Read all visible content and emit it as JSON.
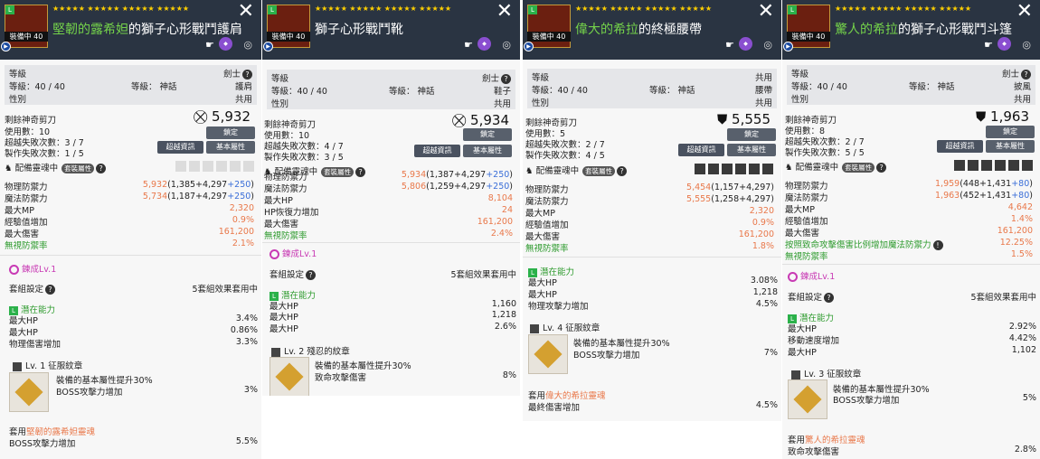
{
  "panels": [
    {
      "stars": "★★★★★ ★★★★★ ★★★★★ ★★★★★",
      "name_prefix": "堅韌的露希妲",
      "name_suffix": "的獅子心形戰鬥護肩",
      "equipped": "裝備中",
      "level_badge": "40",
      "bar": {
        "level_label": "等級",
        "job": "劍士",
        "level": "等級：40 / 40",
        "grade": "等級： 神話",
        "type": "護肩",
        "gender_label": "性別",
        "gender": "共用"
      },
      "scissors": "剩餘神奇剪刀",
      "uses": "使用數：10",
      "fail_transcend": "超越失敗次數：3 / 7",
      "fail_craft": "製作失敗次數：1 / 5",
      "power": "5,932",
      "btn_lock": "鎖定",
      "btn_trans": "超越資訊",
      "btn_basic": "基本屬性",
      "spirit": "配備靈魂中",
      "set_tag": "套裝屬性",
      "stats": [
        {
          "k": "物理防禦力",
          "v": "5,932",
          "d": "(1,385+4,297",
          "p": "+250",
          "e": ")"
        },
        {
          "k": "魔法防禦力",
          "v": "5,734",
          "d": "(1,187+4,297",
          "p": "+250",
          "e": ")"
        },
        {
          "k": "最大MP",
          "v": "2,320"
        },
        {
          "k": "經驗值增加",
          "v": "0.9%"
        },
        {
          "k": "最大傷害",
          "v": "161,200"
        },
        {
          "k": "無視防禦率",
          "v": "2.1%"
        }
      ],
      "refine": "鍊成Lv.1",
      "set_label": "套組設定",
      "set_value": "5套組效果套用中",
      "potential": "潛在能力",
      "pot": [
        {
          "k": "最大HP",
          "v": "3.4%"
        },
        {
          "k": "最大HP",
          "v": "0.86%"
        },
        {
          "k": "物理傷害增加",
          "v": "3.3%"
        }
      ],
      "emblem_title": "Lv. 1 征服紋章",
      "emblem_line1": "裝備的基本屬性提升30%",
      "emblem_line2": "BOSS攻擊力增加",
      "emblem_val": "3%",
      "soul_prefix": "套用",
      "soul_name": "堅韌的露希妲靈魂",
      "soul_line": "BOSS攻擊力增加",
      "soul_val": "5.5%"
    },
    {
      "stars": "★★★★★ ★★★★★ ★★★★★ ★★★★★",
      "name_prefix": "",
      "name_suffix": "獅子心形戰鬥靴",
      "equipped": "裝備中",
      "level_badge": "40",
      "bar": {
        "level_label": "等級",
        "job": "劍士",
        "level": "等級：40 / 40",
        "grade": "等級： 神話",
        "type": "鞋子",
        "gender_label": "性別",
        "gender": "共用"
      },
      "scissors": "剩餘神奇剪刀",
      "uses": "使用數：10",
      "fail_transcend": "超越失敗次數：4 / 7",
      "fail_craft": "製作失敗次數：3 / 5",
      "power": "5,934",
      "btn_lock": "鎖定",
      "btn_trans": "超越資訊",
      "btn_basic": "基本屬性",
      "spirit": "配備靈魂中",
      "set_tag": "套裝屬性",
      "stats": [
        {
          "k": "物理防禦力",
          "v": "5,934",
          "d": "(1,387+4,297",
          "p": "+250",
          "e": ")"
        },
        {
          "k": "魔法防禦力",
          "v": "5,806",
          "d": "(1,259+4,297",
          "p": "+250",
          "e": ")"
        },
        {
          "k": "最大HP",
          "v": "8,104"
        },
        {
          "k": "HP恢復力增加",
          "v": "24"
        },
        {
          "k": "最大傷害",
          "v": "161,200"
        },
        {
          "k": "無視防禦率",
          "v": "2.4%"
        }
      ],
      "refine": "鍊成Lv.1",
      "set_label": "套組設定",
      "set_value": "5套組效果套用中",
      "potential": "潛在能力",
      "pot": [
        {
          "k": "最大HP",
          "v": "1,160"
        },
        {
          "k": "最大HP",
          "v": "1,218"
        },
        {
          "k": "最大HP",
          "v": "2.6%"
        }
      ],
      "emblem_title": "Lv. 2 殘忍的紋章",
      "emblem_line1": "裝備的基本屬性提升30%",
      "emblem_line2": "致命攻擊傷害",
      "emblem_val": "8%"
    },
    {
      "stars": "★★★★★ ★★★★★ ★★★★★ ★★★★★",
      "name_prefix": "偉大的希拉",
      "name_suffix": "的終極腰帶",
      "equipped": "裝備中",
      "level_badge": "40",
      "bar": {
        "level_label": "等級",
        "job": "共用",
        "level": "等級：40 / 40",
        "grade": "等級： 神話",
        "type": "腰帶",
        "gender_label": "性別",
        "gender": "共用"
      },
      "scissors": "剩餘神奇剪刀",
      "uses": "使用數：5",
      "fail_transcend": "超越失敗次數：2 / 7",
      "fail_craft": "製作失敗次數：4 / 5",
      "power": "5,555",
      "btn_lock": "鎖定",
      "btn_trans": "超越資訊",
      "btn_basic": "基本屬性",
      "spirit": "配備靈魂中",
      "set_tag": "套裝屬性",
      "stats": [
        {
          "k": "物理防禦力",
          "v": "5,454",
          "d": "(1,157+4,297)",
          "p": "",
          "e": ""
        },
        {
          "k": "魔法防禦力",
          "v": "5,555",
          "d": "(1,258+4,297)",
          "p": "",
          "e": ""
        },
        {
          "k": "最大MP",
          "v": "2,320"
        },
        {
          "k": "經驗值增加",
          "v": "0.9%"
        },
        {
          "k": "最大傷害",
          "v": "161,200"
        },
        {
          "k": "無視防禦率",
          "v": "1.8%"
        }
      ],
      "potential": "潛在能力",
      "pot": [
        {
          "k": "最大HP",
          "v": "3.08%"
        },
        {
          "k": "最大HP",
          "v": "1,218"
        },
        {
          "k": "物理攻擊力增加",
          "v": "4.5%"
        }
      ],
      "emblem_title": "Lv. 4 征服紋章",
      "emblem_line1": "裝備的基本屬性提升30%",
      "emblem_line2": "BOSS攻擊力增加",
      "emblem_val": "7%",
      "soul_prefix": "套用",
      "soul_name": "偉大的希拉靈魂",
      "soul_line": "最終傷害增加",
      "soul_val": "4.5%"
    },
    {
      "stars": "★★★★★ ★★★★★ ★★★★★ ★★★★★",
      "name_prefix": "驚人的希拉",
      "name_suffix": "的獅子心形戰鬥斗篷",
      "equipped": "裝備中",
      "level_badge": "40",
      "bar": {
        "level_label": "等級",
        "job": "劍士",
        "level": "等級：40 / 40",
        "grade": "等級： 神話",
        "type": "披風",
        "gender_label": "性別",
        "gender": "共用"
      },
      "scissors": "剩餘神奇剪刀",
      "uses": "使用數：8",
      "fail_transcend": "超越失敗次數：2 / 7",
      "fail_craft": "製作失敗次數：5 / 5",
      "power": "1,963",
      "btn_lock": "鎖定",
      "btn_trans": "超越資訊",
      "btn_basic": "基本屬性",
      "spirit": "配備靈魂中",
      "set_tag": "套裝屬性",
      "stats": [
        {
          "k": "物理防禦力",
          "v": "1,959",
          "d": "(448+1,431",
          "p": "+80",
          "e": ")"
        },
        {
          "k": "魔法防禦力",
          "v": "1,963",
          "d": "(452+1,431",
          "p": "+80",
          "e": ")"
        },
        {
          "k": "最大MP",
          "v": "4,642"
        },
        {
          "k": "經驗值增加",
          "v": "1.4%"
        },
        {
          "k": "最大傷害",
          "v": "161,200"
        },
        {
          "k": "按照致命攻擊傷害比例增加魔法防禦力",
          "v": "12.25%"
        },
        {
          "k": "無視防禦率",
          "v": "1.5%"
        }
      ],
      "refine": "鍊成Lv.1",
      "set_label": "套組設定",
      "set_value": "5套組效果套用中",
      "potential": "潛在能力",
      "pot": [
        {
          "k": "最大HP",
          "v": "2.92%"
        },
        {
          "k": "移動速度增加",
          "v": "4.42%"
        },
        {
          "k": "最大HP",
          "v": "1,102"
        }
      ],
      "emblem_title": "Lv. 3 征服紋章",
      "emblem_line1": "裝備的基本屬性提升30%",
      "emblem_line2": "BOSS攻擊力增加",
      "emblem_val": "5%",
      "soul_prefix": "套用",
      "soul_name": "驚人的希拉靈魂",
      "soul_line": "致命攻擊傷害",
      "soul_val": "2.8%"
    }
  ]
}
